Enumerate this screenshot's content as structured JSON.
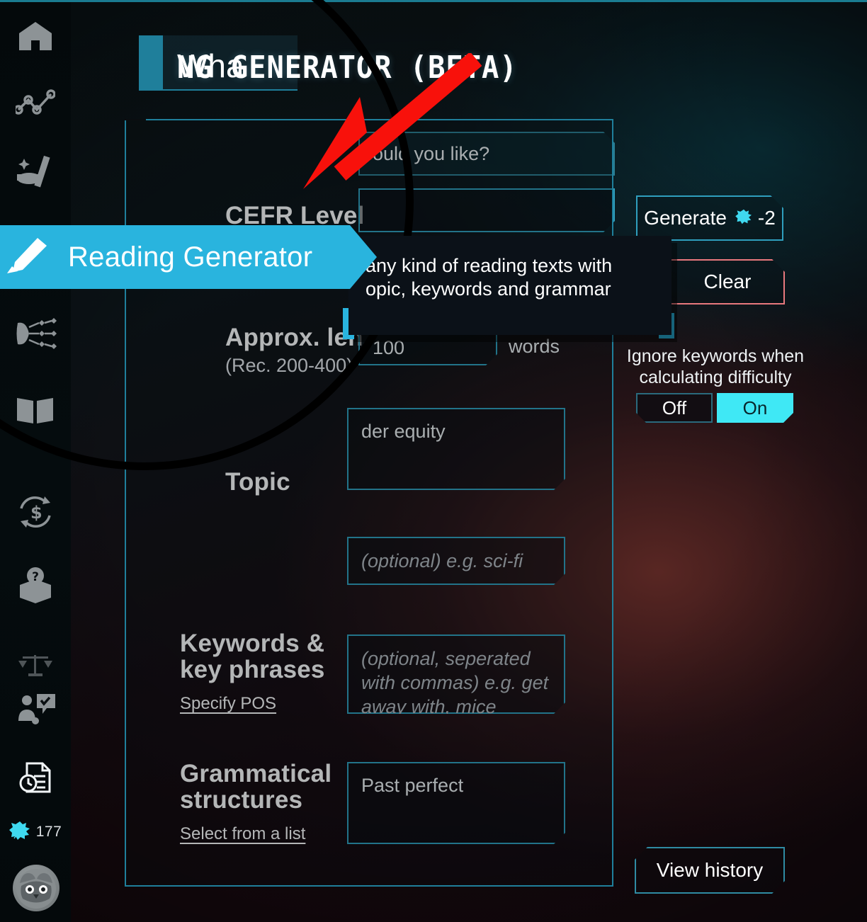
{
  "app": {
    "page_title": "NG GENERATOR (BETA)",
    "title_overlay_fragment": "Wha"
  },
  "sidebar": {
    "items": [
      {
        "icon": "home-icon",
        "label": "Home"
      },
      {
        "icon": "analytics-chart-icon",
        "label": "Analytics"
      },
      {
        "icon": "magic-wand-icon",
        "label": "Magic Tools"
      },
      {
        "icon": "pencil-icon",
        "label": "Reading Generator"
      },
      {
        "icon": "mind-map-icon",
        "label": "Mind Map"
      },
      {
        "icon": "open-book-icon",
        "label": "Library"
      },
      {
        "icon": "currency-exchange-icon",
        "label": "Exchange"
      },
      {
        "icon": "mystery-box-icon",
        "label": "Mystery Box"
      },
      {
        "icon": "scales-icon",
        "label": "Balance"
      },
      {
        "icon": "person-feedback-icon",
        "label": "Feedback"
      }
    ],
    "active_index": 3,
    "history_icon": "document-clock-icon",
    "credits_icon": "leaf-credit-icon",
    "credits_count": "177",
    "avatar_icon": "cat-avatar"
  },
  "flyout": {
    "icon": "pencil-icon",
    "label": "Reading Generator"
  },
  "tooltip": {
    "line1": "any kind of reading texts with",
    "line2": "opic, keywords and grammar"
  },
  "form": {
    "header_question": "ould you like?",
    "cefr": {
      "label": "CEFR Level",
      "value": ""
    },
    "length": {
      "label": "Approx. len",
      "sub_label": "(Rec. 200-400)",
      "value": "100",
      "unit": "words"
    },
    "topic": {
      "label": "Topic",
      "value": "der equity"
    },
    "genre": {
      "placeholder": "(optional) e.g. sci-fi",
      "value": ""
    },
    "keywords": {
      "label_line1": "Keywords &",
      "label_line2": "key phrases",
      "link": "Specify POS",
      "placeholder": "(optional, seperated with commas) e.g. get away with, mice",
      "value": ""
    },
    "grammar": {
      "label_line1": "Grammatical",
      "label_line2": "structures",
      "link": "Select from a list",
      "value": "Past perfect"
    }
  },
  "actions": {
    "generate_label": "Generate",
    "generate_icon": "leaf-credit-icon",
    "generate_cost": "-2",
    "clear_label": "Clear",
    "view_history_label": "View history"
  },
  "ignore_keywords": {
    "note_line1": "Ignore keywords when",
    "note_line2": "calculating difficulty",
    "off_label": "Off",
    "on_label": "On",
    "selected": "On"
  },
  "colors": {
    "accent_cyan": "#2f9fbe",
    "flyout_blue": "#29b4de",
    "toggle_on": "#3fe8f5",
    "danger_red": "#e8787d",
    "arrow_red": "#f8110b"
  }
}
